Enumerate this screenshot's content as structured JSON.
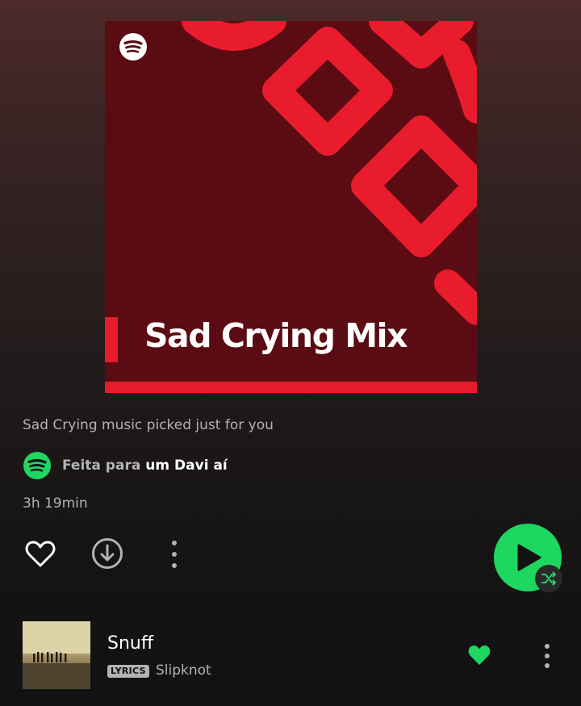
{
  "cover": {
    "title": "Sad Crying Mix",
    "logo_icon": "spotify-logo-icon"
  },
  "playlist": {
    "description": "Sad Crying music picked just for you",
    "owner_prefix": "Feita para",
    "owner_name": "um Davi aí",
    "owner_icon": "spotify-logo-icon",
    "duration": "3h 19min"
  },
  "actions": {
    "like_icon": "heart-outline-icon",
    "download_icon": "download-icon",
    "more_icon": "more-vertical-icon",
    "play_icon": "play-icon",
    "shuffle_icon": "shuffle-icon"
  },
  "tracks": [
    {
      "title": "Snuff",
      "badge": "LYRICS",
      "artist": "Slipknot",
      "liked": true,
      "like_icon": "heart-filled-icon",
      "more_icon": "more-vertical-icon"
    }
  ],
  "colors": {
    "accent": "#1ed760",
    "cover_background": "#5b0b12",
    "cover_pattern": "#e91c2d",
    "text_secondary": "#b3b3b3"
  }
}
